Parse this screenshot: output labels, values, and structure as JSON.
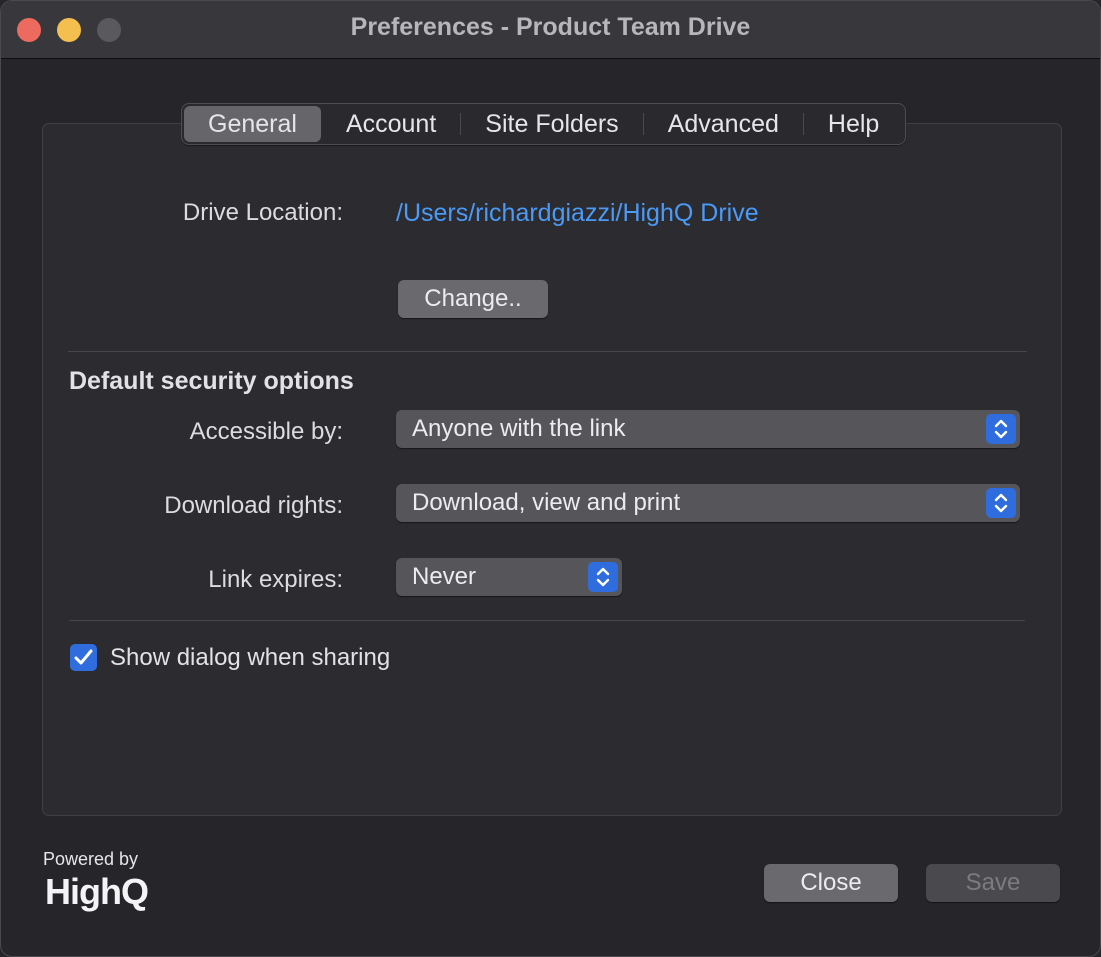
{
  "window": {
    "title": "Preferences - Product Team Drive"
  },
  "tabs": [
    {
      "label": "General",
      "active": true
    },
    {
      "label": "Account",
      "active": false
    },
    {
      "label": "Site Folders",
      "active": false
    },
    {
      "label": "Advanced",
      "active": false
    },
    {
      "label": "Help",
      "active": false
    }
  ],
  "general": {
    "drive_location_label": "Drive Location:",
    "drive_location_path": "/Users/richardgiazzi/HighQ Drive",
    "change_button": "Change..",
    "security_title": "Default security options",
    "accessible_by_label": "Accessible by:",
    "accessible_by_value": "Anyone with the link",
    "download_rights_label": "Download rights:",
    "download_rights_value": "Download, view and print",
    "link_expires_label": "Link expires:",
    "link_expires_value": "Never",
    "show_dialog_label": "Show dialog when sharing",
    "show_dialog_checked": true
  },
  "footer": {
    "powered_by": "Powered by",
    "brand": "HighQ",
    "close_button": "Close",
    "save_button": "Save",
    "save_enabled": false
  },
  "colors": {
    "accent": "#2f6ddf",
    "link": "#4a9af6"
  },
  "icons": {
    "checkbox": "checkmark-icon",
    "select": "chevron-up-down-icon"
  }
}
